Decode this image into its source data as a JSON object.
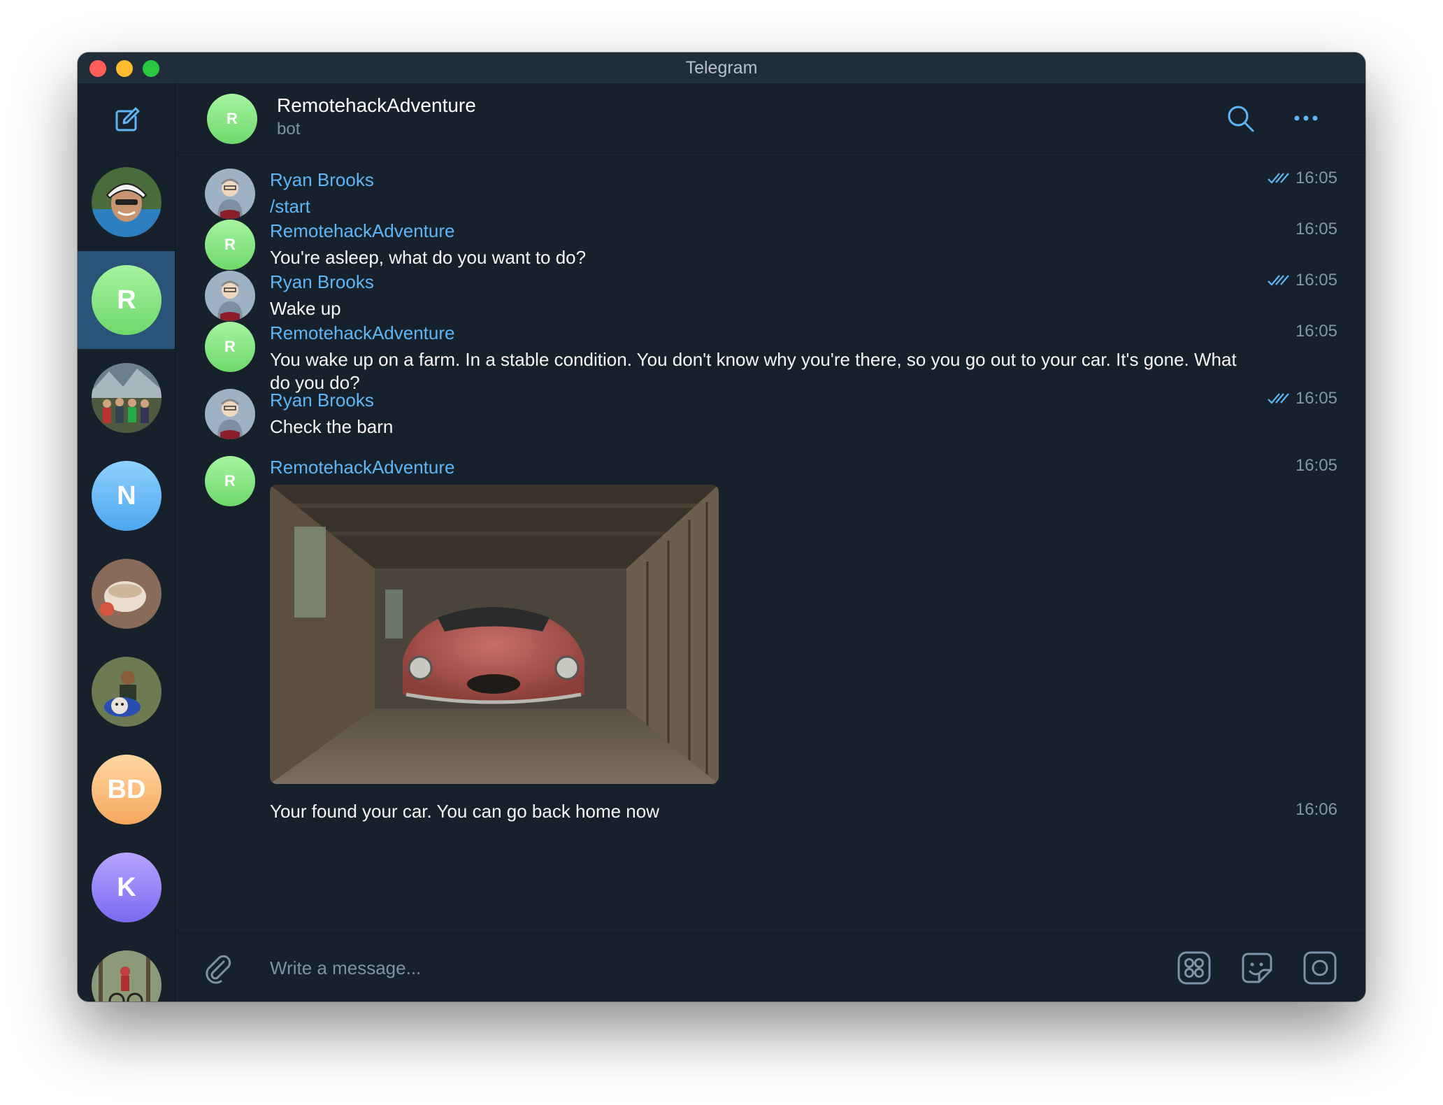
{
  "window": {
    "title": "Telegram"
  },
  "sidebar": {
    "compose_icon": "compose-icon",
    "chats": [
      {
        "name": "chat-avatar-photo-1",
        "type": "photo",
        "initials": ""
      },
      {
        "name": "chat-avatar-remotehackadventure",
        "type": "initials",
        "initials": "R",
        "color": "green",
        "selected": true
      },
      {
        "name": "chat-avatar-photo-2",
        "type": "photo",
        "initials": ""
      },
      {
        "name": "chat-avatar-n",
        "type": "initials",
        "initials": "N",
        "color": "blue"
      },
      {
        "name": "chat-avatar-photo-3",
        "type": "photo",
        "initials": ""
      },
      {
        "name": "chat-avatar-photo-4",
        "type": "photo",
        "initials": ""
      },
      {
        "name": "chat-avatar-bd",
        "type": "initials",
        "initials": "BD",
        "color": "orange"
      },
      {
        "name": "chat-avatar-k",
        "type": "initials",
        "initials": "K",
        "color": "purple"
      },
      {
        "name": "chat-avatar-photo-5",
        "type": "photo",
        "initials": ""
      }
    ]
  },
  "header": {
    "avatar_initial": "R",
    "title": "RemotehackAdventure",
    "subtitle": "bot",
    "search_icon": "search-icon",
    "more_icon": "more-icon"
  },
  "messages": [
    {
      "sender": "Ryan Brooks",
      "text": "/start",
      "time": "16:05",
      "read": true
    },
    {
      "sender": "RemotehackAdventure",
      "avatar_initial": "R",
      "text": "You're asleep, what do you want to do?",
      "time": "16:05"
    },
    {
      "sender": "Ryan Brooks",
      "text": "Wake up",
      "time": "16:05",
      "read": true
    },
    {
      "sender": "RemotehackAdventure",
      "avatar_initial": "R",
      "text": "You wake up on a farm. In a stable condition. You don't know why you're there, so you go out to your car. It's gone. What do you do?",
      "time": "16:05"
    },
    {
      "sender": "Ryan Brooks",
      "text": "Check the barn",
      "time": "16:05",
      "read": true
    },
    {
      "sender": "RemotehackAdventure",
      "avatar_initial": "R",
      "photo": "barn-car-photo",
      "time": "16:05"
    },
    {
      "text": "Your found your car. You can go back home now",
      "time": "16:06"
    }
  ],
  "composer": {
    "placeholder": "Write a message...",
    "attach_icon": "paperclip-icon",
    "commands_icon": "bot-commands-icon",
    "sticker_icon": "sticker-icon",
    "voice_icon": "record-icon"
  },
  "colors": {
    "background": "#17212b",
    "accent": "#5eb5f7",
    "selected": "#2b5278",
    "text": "#f5f5f5",
    "muted": "#7f91a4"
  }
}
